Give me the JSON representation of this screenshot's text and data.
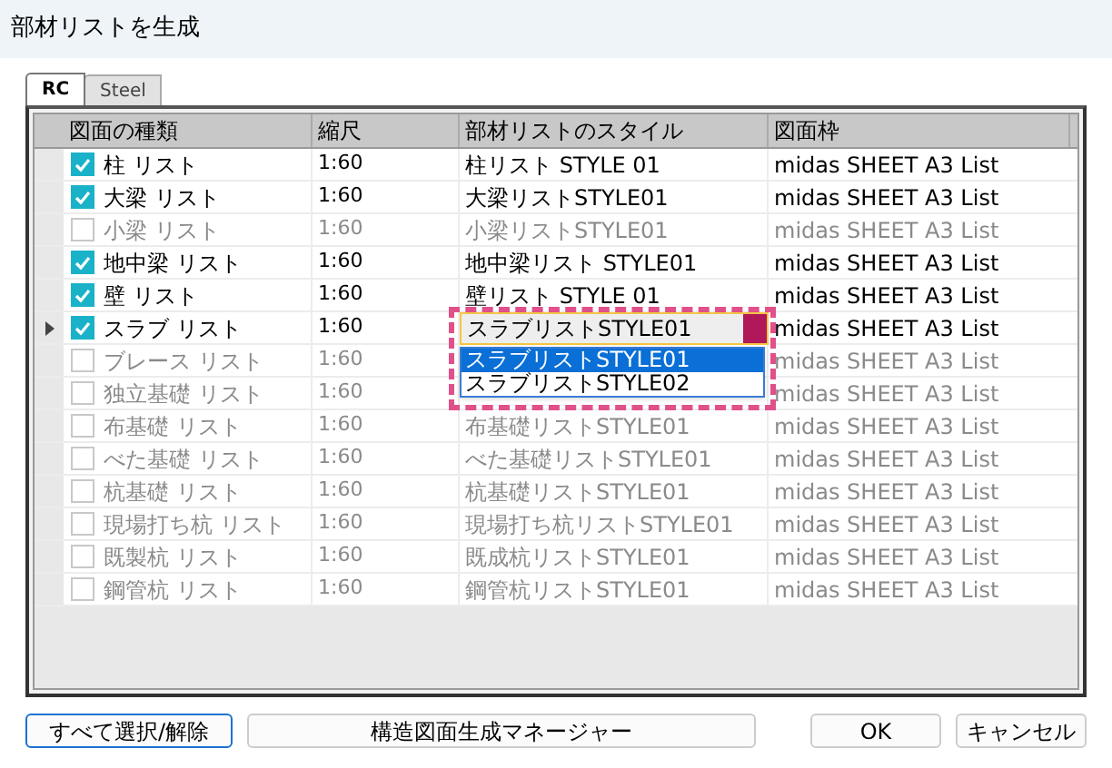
{
  "window": {
    "title": "部材リストを生成"
  },
  "tabs": [
    {
      "label": "RC",
      "selected": true
    },
    {
      "label": "Steel",
      "selected": false
    }
  ],
  "table": {
    "columns": [
      "図面の種類",
      "縮尺",
      "部材リストのスタイル",
      "図面枠"
    ],
    "rows": [
      {
        "checked": true,
        "current": false,
        "name": "柱 リスト",
        "scale": "1:60",
        "style": "柱リスト STYLE 01",
        "frame": "midas SHEET A3 List"
      },
      {
        "checked": true,
        "current": false,
        "name": "大梁 リスト",
        "scale": "1:60",
        "style": "大梁リストSTYLE01",
        "frame": "midas SHEET A3 List"
      },
      {
        "checked": false,
        "current": false,
        "name": "小梁 リスト",
        "scale": "1:60",
        "style": "小梁リストSTYLE01",
        "frame": "midas SHEET A3 List"
      },
      {
        "checked": true,
        "current": false,
        "name": "地中梁 リスト",
        "scale": "1:60",
        "style": "地中梁リスト STYLE01",
        "frame": "midas SHEET A3 List"
      },
      {
        "checked": true,
        "current": false,
        "name": "壁 リスト",
        "scale": "1:60",
        "style": "壁リスト STYLE 01",
        "frame": "midas SHEET A3 List"
      },
      {
        "checked": true,
        "current": true,
        "name": "スラブ リスト",
        "scale": "1:60",
        "style": "スラブリストSTYLE01",
        "frame": "midas SHEET A3 List",
        "style_options": [
          {
            "label": "スラブリストSTYLE01",
            "selected": true
          },
          {
            "label": "スラブリストSTYLE02",
            "selected": false
          }
        ]
      },
      {
        "checked": false,
        "current": false,
        "name": "ブレース リスト",
        "scale": "1:60",
        "frame": "midas SHEET A3 List"
      },
      {
        "checked": false,
        "current": false,
        "name": "独立基礎 リスト",
        "scale": "1:60",
        "frame": "midas SHEET A3 List"
      },
      {
        "checked": false,
        "current": false,
        "name": "布基礎 リスト",
        "scale": "1:60",
        "style": "布基礎リストSTYLE01",
        "frame": "midas SHEET A3 List"
      },
      {
        "checked": false,
        "current": false,
        "name": "べた基礎 リスト",
        "scale": "1:60",
        "style": "べた基礎リストSTYLE01",
        "frame": "midas SHEET A3 List"
      },
      {
        "checked": false,
        "current": false,
        "name": "杭基礎 リスト",
        "scale": "1:60",
        "style": "杭基礎リストSTYLE01",
        "frame": "midas SHEET A3 List"
      },
      {
        "checked": false,
        "current": false,
        "name": "現場打ち杭 リスト",
        "scale": "1:60",
        "style": "現場打ち杭リストSTYLE01",
        "frame": "midas SHEET A3 List"
      },
      {
        "checked": false,
        "current": false,
        "name": "既製杭 リスト",
        "scale": "1:60",
        "style": "既成杭リストSTYLE01",
        "frame": "midas SHEET A3 List"
      },
      {
        "checked": false,
        "current": false,
        "name": "鋼管杭 リスト",
        "scale": "1:60",
        "style": "鋼管杭リストSTYLE01",
        "frame": "midas SHEET A3 List"
      }
    ]
  },
  "buttons": [
    {
      "label": "すべて選択/解除",
      "kind": "default"
    },
    {
      "label": "構造図面生成マネージャー",
      "kind": "wide"
    },
    {
      "label": "OK",
      "kind": "normal"
    },
    {
      "label": "キャンセル",
      "kind": "normal"
    }
  ]
}
